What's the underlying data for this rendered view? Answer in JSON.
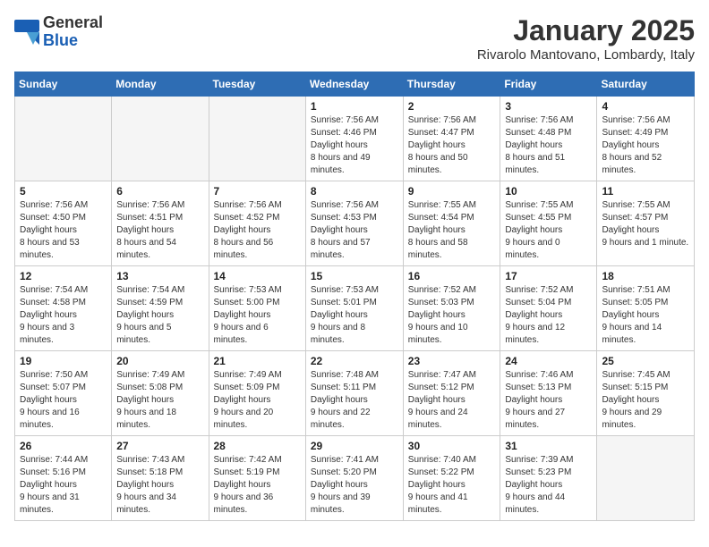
{
  "logo": {
    "general": "General",
    "blue": "Blue"
  },
  "title": "January 2025",
  "subtitle": "Rivarolo Mantovano, Lombardy, Italy",
  "days_of_week": [
    "Sunday",
    "Monday",
    "Tuesday",
    "Wednesday",
    "Thursday",
    "Friday",
    "Saturday"
  ],
  "weeks": [
    [
      {
        "day": "",
        "empty": true
      },
      {
        "day": "",
        "empty": true
      },
      {
        "day": "",
        "empty": true
      },
      {
        "day": "1",
        "sunrise": "7:56 AM",
        "sunset": "4:46 PM",
        "daylight": "8 hours and 49 minutes."
      },
      {
        "day": "2",
        "sunrise": "7:56 AM",
        "sunset": "4:47 PM",
        "daylight": "8 hours and 50 minutes."
      },
      {
        "day": "3",
        "sunrise": "7:56 AM",
        "sunset": "4:48 PM",
        "daylight": "8 hours and 51 minutes."
      },
      {
        "day": "4",
        "sunrise": "7:56 AM",
        "sunset": "4:49 PM",
        "daylight": "8 hours and 52 minutes."
      }
    ],
    [
      {
        "day": "5",
        "sunrise": "7:56 AM",
        "sunset": "4:50 PM",
        "daylight": "8 hours and 53 minutes."
      },
      {
        "day": "6",
        "sunrise": "7:56 AM",
        "sunset": "4:51 PM",
        "daylight": "8 hours and 54 minutes."
      },
      {
        "day": "7",
        "sunrise": "7:56 AM",
        "sunset": "4:52 PM",
        "daylight": "8 hours and 56 minutes."
      },
      {
        "day": "8",
        "sunrise": "7:56 AM",
        "sunset": "4:53 PM",
        "daylight": "8 hours and 57 minutes."
      },
      {
        "day": "9",
        "sunrise": "7:55 AM",
        "sunset": "4:54 PM",
        "daylight": "8 hours and 58 minutes."
      },
      {
        "day": "10",
        "sunrise": "7:55 AM",
        "sunset": "4:55 PM",
        "daylight": "9 hours and 0 minutes."
      },
      {
        "day": "11",
        "sunrise": "7:55 AM",
        "sunset": "4:57 PM",
        "daylight": "9 hours and 1 minute."
      }
    ],
    [
      {
        "day": "12",
        "sunrise": "7:54 AM",
        "sunset": "4:58 PM",
        "daylight": "9 hours and 3 minutes."
      },
      {
        "day": "13",
        "sunrise": "7:54 AM",
        "sunset": "4:59 PM",
        "daylight": "9 hours and 5 minutes."
      },
      {
        "day": "14",
        "sunrise": "7:53 AM",
        "sunset": "5:00 PM",
        "daylight": "9 hours and 6 minutes."
      },
      {
        "day": "15",
        "sunrise": "7:53 AM",
        "sunset": "5:01 PM",
        "daylight": "9 hours and 8 minutes."
      },
      {
        "day": "16",
        "sunrise": "7:52 AM",
        "sunset": "5:03 PM",
        "daylight": "9 hours and 10 minutes."
      },
      {
        "day": "17",
        "sunrise": "7:52 AM",
        "sunset": "5:04 PM",
        "daylight": "9 hours and 12 minutes."
      },
      {
        "day": "18",
        "sunrise": "7:51 AM",
        "sunset": "5:05 PM",
        "daylight": "9 hours and 14 minutes."
      }
    ],
    [
      {
        "day": "19",
        "sunrise": "7:50 AM",
        "sunset": "5:07 PM",
        "daylight": "9 hours and 16 minutes."
      },
      {
        "day": "20",
        "sunrise": "7:49 AM",
        "sunset": "5:08 PM",
        "daylight": "9 hours and 18 minutes."
      },
      {
        "day": "21",
        "sunrise": "7:49 AM",
        "sunset": "5:09 PM",
        "daylight": "9 hours and 20 minutes."
      },
      {
        "day": "22",
        "sunrise": "7:48 AM",
        "sunset": "5:11 PM",
        "daylight": "9 hours and 22 minutes."
      },
      {
        "day": "23",
        "sunrise": "7:47 AM",
        "sunset": "5:12 PM",
        "daylight": "9 hours and 24 minutes."
      },
      {
        "day": "24",
        "sunrise": "7:46 AM",
        "sunset": "5:13 PM",
        "daylight": "9 hours and 27 minutes."
      },
      {
        "day": "25",
        "sunrise": "7:45 AM",
        "sunset": "5:15 PM",
        "daylight": "9 hours and 29 minutes."
      }
    ],
    [
      {
        "day": "26",
        "sunrise": "7:44 AM",
        "sunset": "5:16 PM",
        "daylight": "9 hours and 31 minutes."
      },
      {
        "day": "27",
        "sunrise": "7:43 AM",
        "sunset": "5:18 PM",
        "daylight": "9 hours and 34 minutes."
      },
      {
        "day": "28",
        "sunrise": "7:42 AM",
        "sunset": "5:19 PM",
        "daylight": "9 hours and 36 minutes."
      },
      {
        "day": "29",
        "sunrise": "7:41 AM",
        "sunset": "5:20 PM",
        "daylight": "9 hours and 39 minutes."
      },
      {
        "day": "30",
        "sunrise": "7:40 AM",
        "sunset": "5:22 PM",
        "daylight": "9 hours and 41 minutes."
      },
      {
        "day": "31",
        "sunrise": "7:39 AM",
        "sunset": "5:23 PM",
        "daylight": "9 hours and 44 minutes."
      },
      {
        "day": "",
        "empty": true
      }
    ]
  ]
}
